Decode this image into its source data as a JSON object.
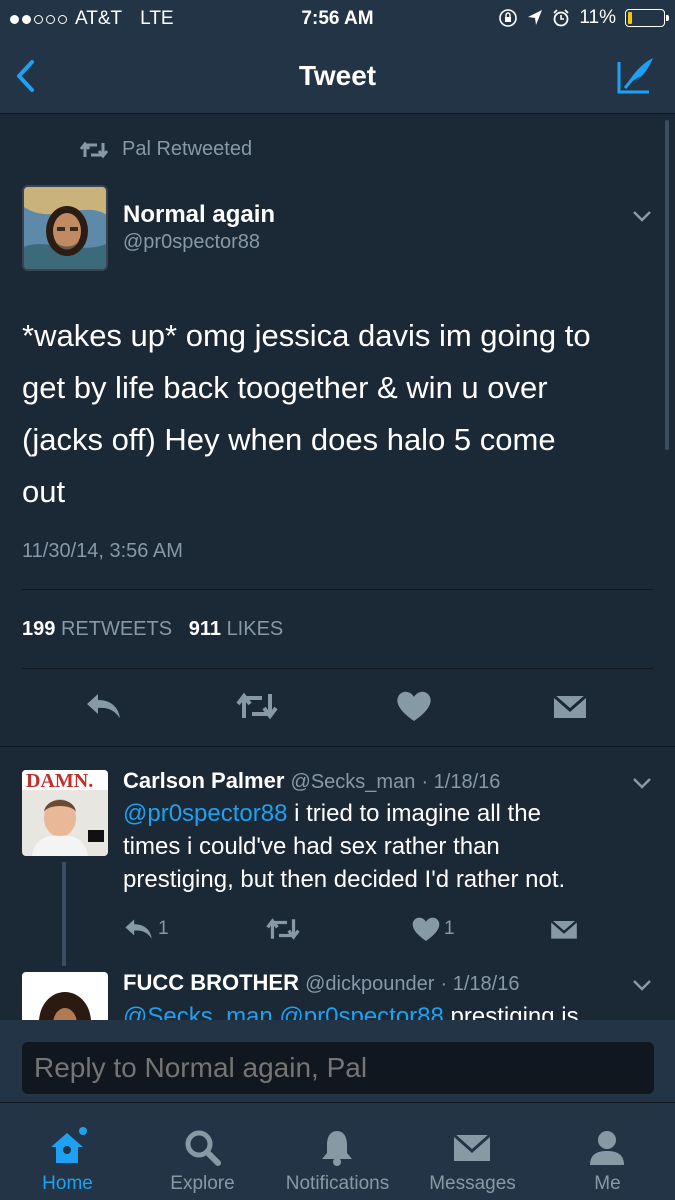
{
  "status_bar": {
    "carrier": "AT&T",
    "network": "LTE",
    "time": "7:56 AM",
    "battery_percent": "11%",
    "battery_level": 0.11,
    "signal_bars_filled": 2,
    "signal_bars_total": 5
  },
  "nav": {
    "title": "Tweet"
  },
  "tweet": {
    "retweeted_by": "Pal Retweeted",
    "author_name": "Normal again",
    "author_handle": "@pr0spector88",
    "text_lines": [
      "*wakes up* omg jessica davis im going to",
      "get by life back toogether & win u over",
      "(jacks off) Hey when does halo 5 come",
      "out"
    ],
    "timestamp": "11/30/14, 3:56 AM",
    "retweets_count": "199",
    "retweets_label": "RETWEETS",
    "likes_count": "911",
    "likes_label": "LIKES"
  },
  "replies": [
    {
      "name": "Carlson Palmer",
      "handle": "@Secks_man",
      "date": "· 1/18/16",
      "mention": "@pr0spector88",
      "text_lines": [
        " i tried to imagine all the",
        "times i could've had sex rather than",
        "prestiging, but then decided I'd rather not."
      ],
      "reply_count": "1",
      "like_count": "1"
    },
    {
      "name": "FUCC BROTHER",
      "handle": "@dickpounder",
      "date": "· 1/18/16",
      "mention": "@Secks_man @pr0spector88",
      "text_partial": " prestiging is"
    }
  ],
  "reply_bar": {
    "placeholder": "Reply to Normal again, Pal"
  },
  "tabs": [
    {
      "label": "Home",
      "icon": "home-icon",
      "active": true
    },
    {
      "label": "Explore",
      "icon": "search-icon",
      "active": false
    },
    {
      "label": "Notifications",
      "icon": "bell-icon",
      "active": false
    },
    {
      "label": "Messages",
      "icon": "envelope-icon",
      "active": false
    },
    {
      "label": "Me",
      "icon": "person-icon",
      "active": false
    }
  ],
  "colors": {
    "background": "#1b2836",
    "bar": "#243447",
    "accent": "#1da1f2",
    "secondary_text": "#8899a6"
  }
}
